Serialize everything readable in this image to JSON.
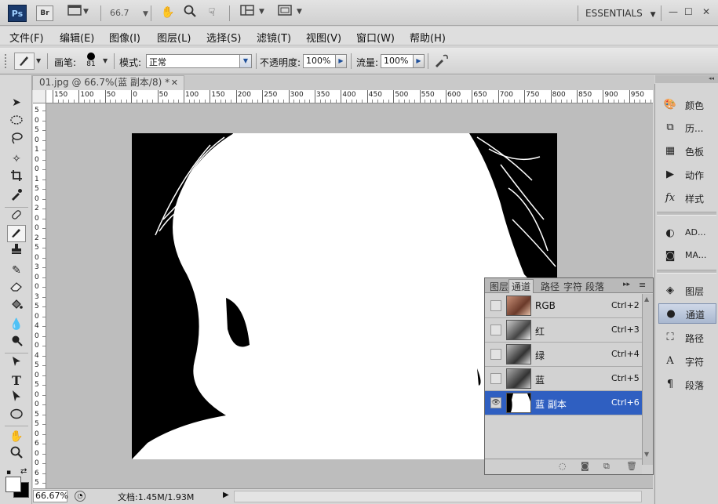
{
  "appbar": {
    "logo": "Ps",
    "bridge": "Br",
    "zoom": "66.7",
    "workspace": "ESSENTIALS"
  },
  "menu": [
    "文件(F)",
    "编辑(E)",
    "图像(I)",
    "图层(L)",
    "选择(S)",
    "滤镜(T)",
    "视图(V)",
    "窗口(W)",
    "帮助(H)"
  ],
  "options": {
    "brush_label": "画笔:",
    "brush_size": "81",
    "mode_label": "模式:",
    "mode_value": "正常",
    "opacity_label": "不透明度:",
    "opacity_value": "100%",
    "flow_label": "流量:",
    "flow_value": "100%"
  },
  "document": {
    "tab_title": "01.jpg @ 66.7%(蓝 副本/8) *"
  },
  "ruler": {
    "top_labels": [
      "150",
      "100",
      "50",
      "0",
      "50",
      "100",
      "150",
      "200",
      "250",
      "300",
      "350",
      "400",
      "450",
      "500",
      "550",
      "600",
      "650",
      "700",
      "750",
      "800",
      "850",
      "900",
      "950"
    ],
    "left_labels": [
      "5",
      "0",
      "5",
      "0",
      "1",
      "0",
      "0",
      "1",
      "5",
      "0",
      "2",
      "0",
      "0",
      "2",
      "5",
      "0",
      "3",
      "0",
      "0",
      "3",
      "5",
      "0",
      "4",
      "0",
      "0",
      "4",
      "5",
      "0",
      "5",
      "0",
      "0",
      "5",
      "5",
      "0",
      "6",
      "0",
      "0",
      "6",
      "5"
    ]
  },
  "status": {
    "zoom": "66.67%",
    "doc": "文档:1.45M/1.93M"
  },
  "dock": {
    "group1": [
      "颜色",
      "历...",
      "色板",
      "动作",
      "样式"
    ],
    "group2": [
      "AD...",
      "MA..."
    ],
    "group3": [
      "图层",
      "通道",
      "路径",
      "字符",
      "段落"
    ]
  },
  "channels_panel": {
    "tabs": [
      "图层",
      "通道",
      "路径",
      "字符",
      "段落"
    ],
    "rows": [
      {
        "name": "RGB",
        "key": "Ctrl+2"
      },
      {
        "name": "红",
        "key": "Ctrl+3"
      },
      {
        "name": "绿",
        "key": "Ctrl+4"
      },
      {
        "name": "蓝",
        "key": "Ctrl+5"
      },
      {
        "name": "蓝 副本",
        "key": "Ctrl+6"
      }
    ]
  },
  "colors": {
    "selection": "#2f5fc1",
    "foreground": "#000000",
    "background": "#ffffff"
  }
}
